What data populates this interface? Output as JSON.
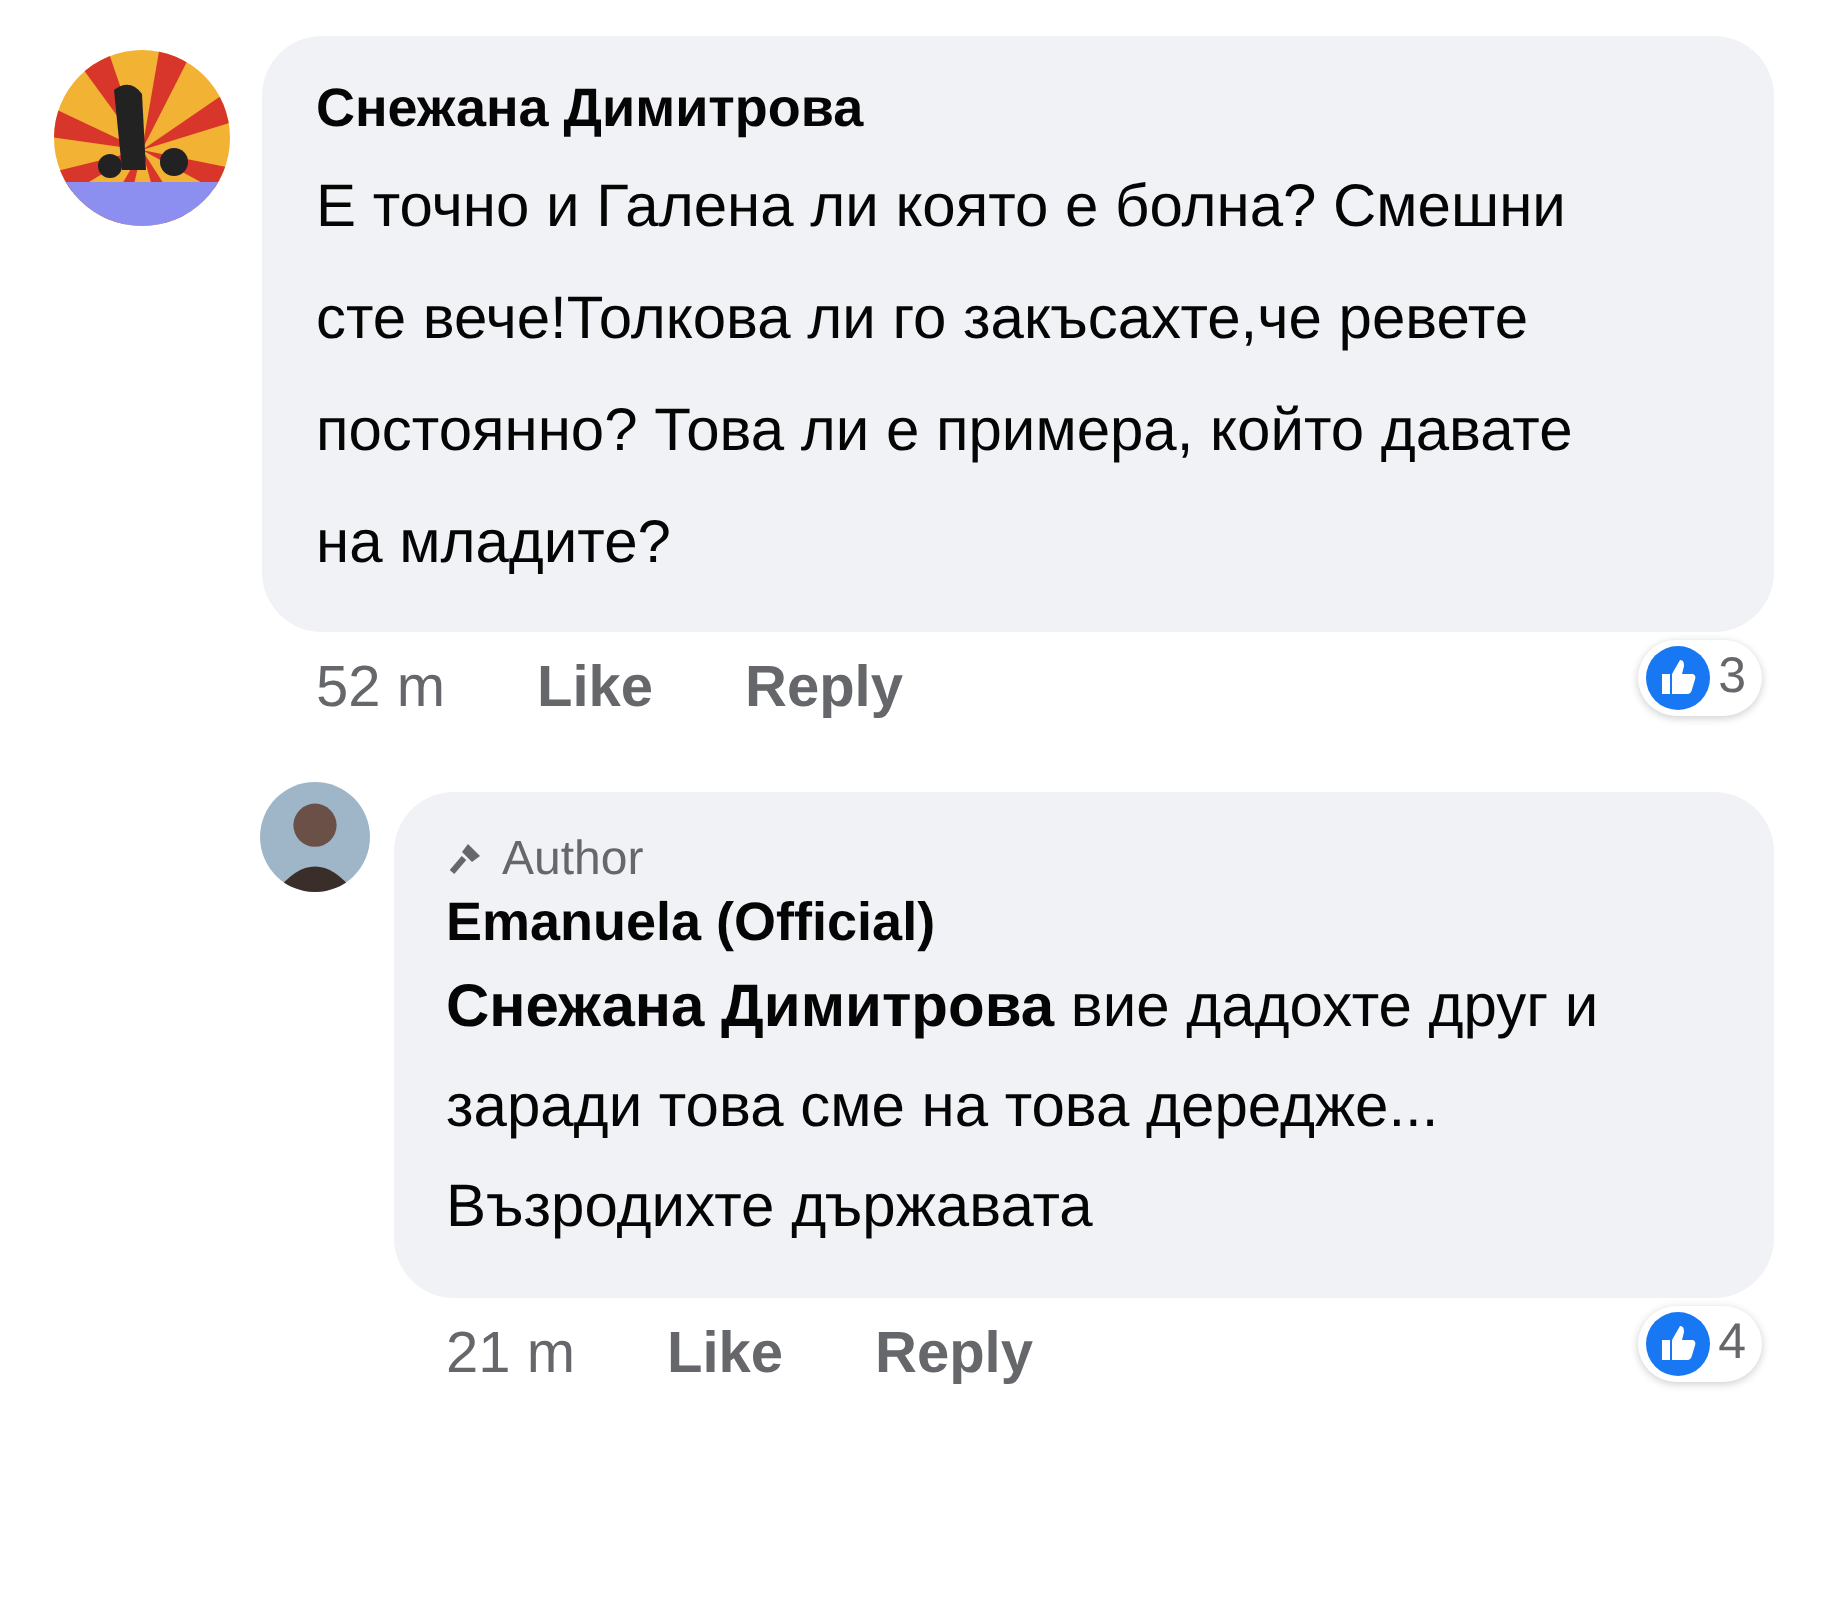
{
  "comments": [
    {
      "avatar": {
        "kind": "picture"
      },
      "author": "Снежана Димитрова",
      "text": "Е точно и Галена ли която е болна? Смешни сте вече!Толкова ли го закъсахте,че ревете постоянно?  Това ли е примера, който давате на младите?",
      "time": "52 m",
      "actions": [
        "Like",
        "Reply"
      ],
      "reaction_count": "3",
      "replies": [
        {
          "avatar": {
            "kind": "silhouette"
          },
          "badge": "Author",
          "author": "Emanuela (Official)",
          "text": "**Снежана Димитрова**  вие дадохте друг и заради това сме на това дередже... Възродихте държавата",
          "time": "21 m",
          "actions": [
            "Like",
            "Reply"
          ],
          "reaction_count": "4"
        }
      ]
    }
  ]
}
